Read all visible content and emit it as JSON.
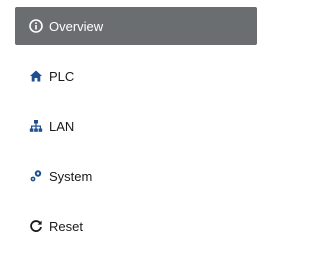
{
  "nav": {
    "items": [
      {
        "label": "Overview",
        "icon": "info-circle-icon",
        "active": true
      },
      {
        "label": "PLC",
        "icon": "home-icon",
        "active": false
      },
      {
        "label": "LAN",
        "icon": "network-icon",
        "active": false
      },
      {
        "label": "System",
        "icon": "cogs-icon",
        "active": false
      },
      {
        "label": "Reset",
        "icon": "refresh-icon",
        "active": false
      }
    ]
  },
  "colors": {
    "active_bg": "#6a6e71",
    "active_text": "#ffffff",
    "text": "#1a1a1a",
    "icon_blue": "#1f4f8f"
  }
}
